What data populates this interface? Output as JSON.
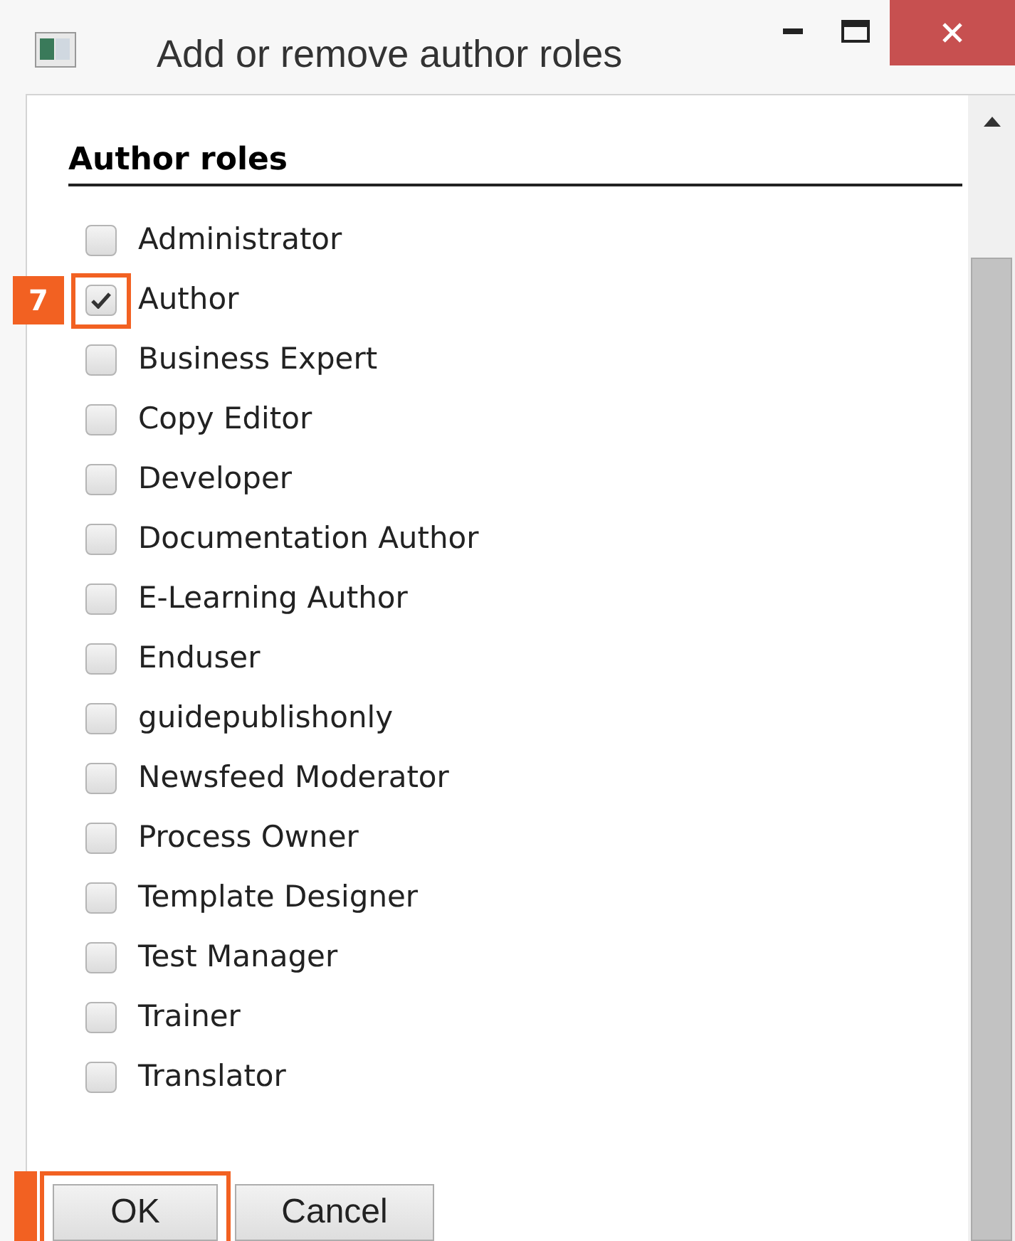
{
  "window": {
    "title": "Add or remove author roles"
  },
  "section": {
    "heading": "Author roles"
  },
  "roles": [
    {
      "label": "Administrator",
      "checked": false
    },
    {
      "label": "Author",
      "checked": true,
      "callout": "7"
    },
    {
      "label": "Business Expert",
      "checked": false
    },
    {
      "label": "Copy Editor",
      "checked": false
    },
    {
      "label": "Developer",
      "checked": false
    },
    {
      "label": "Documentation Author",
      "checked": false
    },
    {
      "label": "E-Learning Author",
      "checked": false
    },
    {
      "label": "Enduser",
      "checked": false
    },
    {
      "label": "guidepublishonly",
      "checked": false
    },
    {
      "label": "Newsfeed Moderator",
      "checked": false
    },
    {
      "label": "Process Owner",
      "checked": false
    },
    {
      "label": "Template Designer",
      "checked": false
    },
    {
      "label": "Test Manager",
      "checked": false
    },
    {
      "label": "Trainer",
      "checked": false
    },
    {
      "label": "Translator",
      "checked": false
    }
  ],
  "buttons": [
    {
      "label": "OK",
      "highlighted": true
    },
    {
      "label": "Cancel",
      "highlighted": false
    }
  ]
}
